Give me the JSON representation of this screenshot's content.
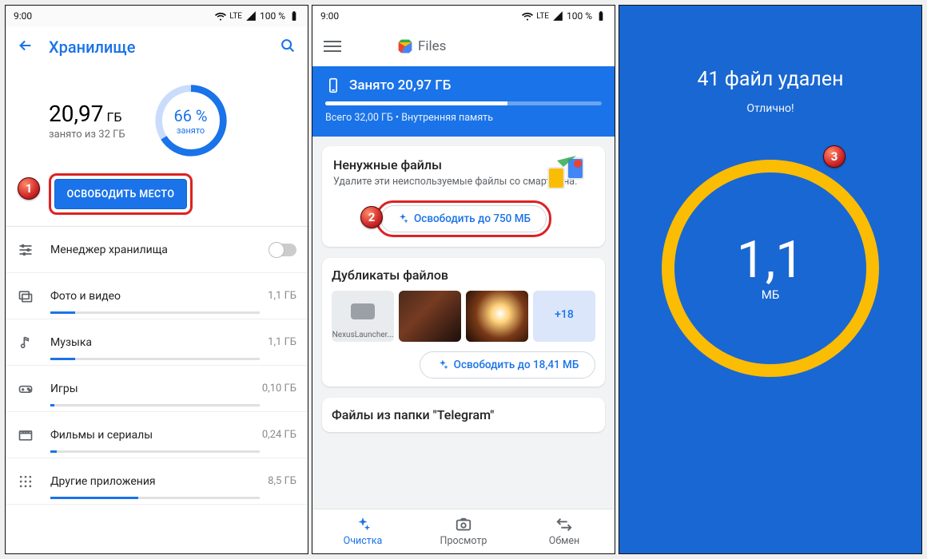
{
  "statusbar": {
    "time": "9:00",
    "net": "LTE",
    "battery": "100 %"
  },
  "p1": {
    "header_title": "Хранилище",
    "used_value": "20,97",
    "used_unit": "ГБ",
    "used_sub": "занято из 32 ГБ",
    "ring_pct": "66 %",
    "ring_sub": "занято",
    "free_button": "ОСВОБОДИТЬ МЕСТО",
    "rows": {
      "manager": "Менеджер хранилища",
      "photos": {
        "label": "Фото и видео",
        "val": "1,1 ГБ",
        "fill": 12
      },
      "music": {
        "label": "Музыка",
        "val": "1,1 ГБ",
        "fill": 12
      },
      "games": {
        "label": "Игры",
        "val": "0,10 ГБ",
        "fill": 2
      },
      "movies": {
        "label": "Фильмы и сериалы",
        "val": "0,24 ГБ",
        "fill": 3
      },
      "other": {
        "label": "Другие приложения",
        "val": "8,5 ГБ",
        "fill": 42
      }
    },
    "step_badge": "1"
  },
  "p2": {
    "app_name": "Files",
    "hero_used": "Занято 20,97 ГБ",
    "hero_sub": "Всего 32,00 ГБ • Внутренняя память",
    "card_junk_title": "Ненужные файлы",
    "card_junk_desc": "Удалите эти неиспользуемые файлы со смартфона.",
    "card_junk_button": "Освободить до 750 МБ",
    "dupes_title": "Дубликаты файлов",
    "dupe_thumb1": "NexusLauncher...",
    "dupe_more": "+18",
    "dupes_button": "Освободить до 18,41 МБ",
    "telegram_card": "Файлы из папки \"Telegram\"",
    "nav": {
      "clean": "Очистка",
      "browse": "Просмотр",
      "share": "Обмен"
    },
    "step_badge": "2"
  },
  "p3": {
    "title": "41 файл удален",
    "sub": "Отлично!",
    "amount": "1,1",
    "unit": "МБ",
    "step_badge": "3"
  }
}
